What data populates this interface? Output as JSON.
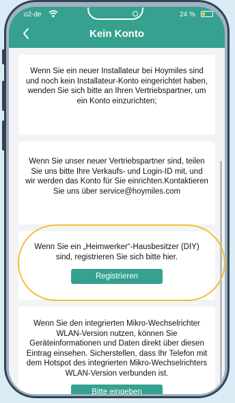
{
  "status_bar": {
    "carrier": "o2-de",
    "battery_percent": "24 %"
  },
  "header": {
    "title": "Kein Konto"
  },
  "cards": [
    {
      "text": "Wenn Sie ein neuer Installateur bei Hoymiles sind und noch kein Installateur-Konto eingerichtet haben, wenden Sie sich bitte an Ihren Vertriebspartner, um ein Konto einzurichten;"
    },
    {
      "text": "Wenn Sie unser neuer Vertriebspartner sind, teilen Sie uns bitte Ihre Verkaufs- und Login-ID mit, und wir werden das Konto für Sie einrichten.Kontaktieren Sie uns über service@hoymiles.com"
    },
    {
      "text": "Wenn Sie ein „Heimwerker“-Hausbesitzer (DIY) sind, registrieren Sie sich bitte hier.",
      "button_label": "Registrieren"
    },
    {
      "text": "Wenn Sie den integrierten Mikro-Wechselrichter WLAN-Version nutzen, können Sie Geräteinformationen und Daten direkt über diesen Eintrag einsehen. Sicherstellen, dass Ihr Telefon mit dem Hotspot des integrierten Mikro-Wechselrichters WLAN-Version verbunden ist.",
      "button_label": "Bitte eingeben"
    }
  ],
  "colors": {
    "accent": "#35a18e",
    "highlight": "#f2be3a",
    "battery": "#f2d33a",
    "phone_frame": "#33424f",
    "phone_body": "#9fb1c5"
  },
  "icons": {
    "back": "chevron-left-icon",
    "wifi": "wifi-icon",
    "battery": "battery-icon"
  }
}
